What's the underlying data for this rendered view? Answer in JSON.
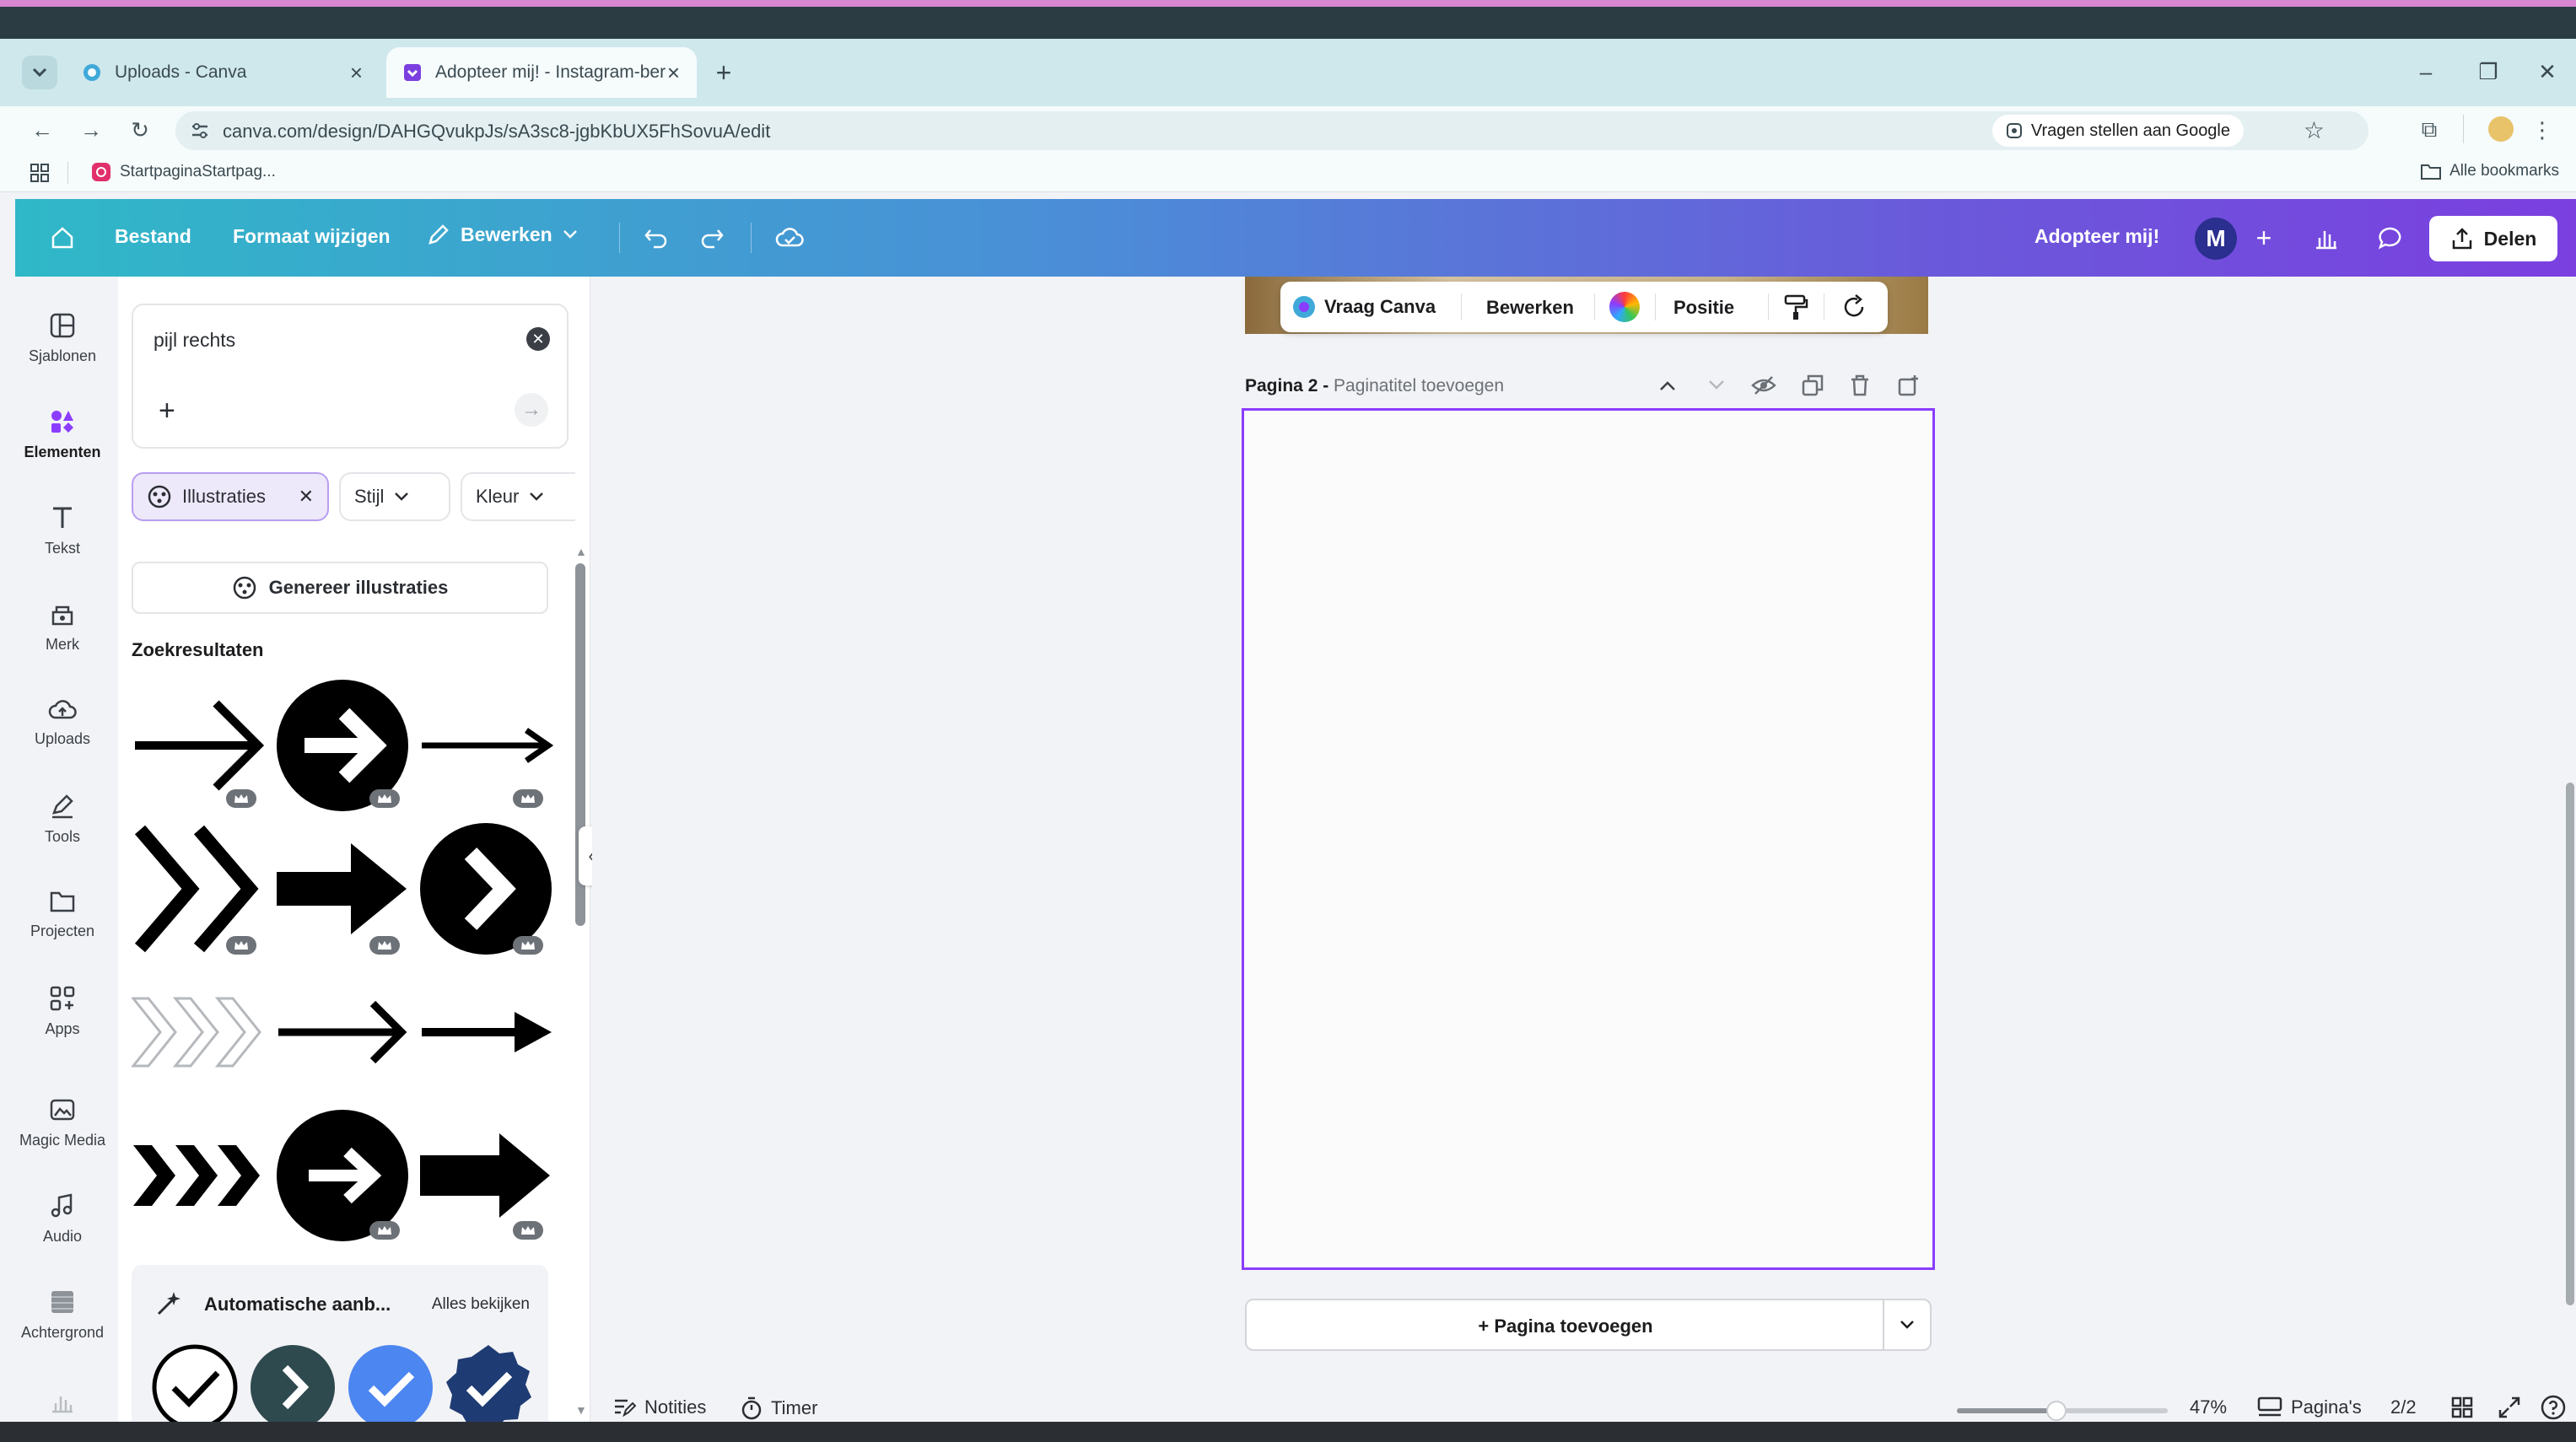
{
  "browser": {
    "tabs": [
      {
        "label": "Uploads - Canva",
        "active": false
      },
      {
        "label": "Adopteer mij! - Instagram-ber",
        "active": true
      }
    ],
    "url": "canva.com/design/DAHGQvukpJs/sA3sc8-jgbKbUX5FhSovuA/edit",
    "ask_google": "Vragen stellen aan Google",
    "bookmark": "StartpaginaStartpag...",
    "all_bookmarks": "Alle bookmarks"
  },
  "header": {
    "file": "Bestand",
    "resize": "Formaat wijzigen",
    "edit": "Bewerken",
    "design_title": "Adopteer mij!",
    "avatar_initial": "M",
    "share": "Delen",
    "gradient_start": "#2fb8c7",
    "gradient_end": "#7b3fe0"
  },
  "rail": {
    "items": [
      {
        "label": "Sjablonen",
        "icon": "templates-icon"
      },
      {
        "label": "Elementen",
        "icon": "elements-icon",
        "active": true
      },
      {
        "label": "Tekst",
        "icon": "text-icon"
      },
      {
        "label": "Merk",
        "icon": "brand-icon"
      },
      {
        "label": "Uploads",
        "icon": "cloud-upload-icon"
      },
      {
        "label": "Tools",
        "icon": "pen-icon"
      },
      {
        "label": "Projecten",
        "icon": "folder-icon"
      },
      {
        "label": "Apps",
        "icon": "apps-icon"
      },
      {
        "label": "Magic Media",
        "icon": "magic-media-icon"
      },
      {
        "label": "Audio",
        "icon": "music-icon"
      },
      {
        "label": "Achtergrond",
        "icon": "background-icon"
      }
    ]
  },
  "panel": {
    "search_value": "pijl rechts",
    "filters": {
      "illustrations": "Illustraties",
      "style": "Stijl",
      "color": "Kleur"
    },
    "generate": "Genereer illustraties",
    "results_title": "Zoekresultaten",
    "auto_suggest": "Automatische aanb...",
    "see_all": "Alles bekijken"
  },
  "canvas": {
    "context_toolbar": {
      "ask": "Vraag Canva",
      "edit": "Bewerken",
      "position": "Positie"
    },
    "page_label": "Pagina 2 -",
    "page_title_placeholder": "Paginatitel toevoegen",
    "add_page": "+ Pagina toevoegen",
    "page_border_color": "#8b3dff"
  },
  "footer": {
    "notes": "Notities",
    "timer": "Timer",
    "zoom": "47%",
    "zoom_level": 0.47,
    "pages": "Pagina's",
    "page_count": "2/2"
  }
}
